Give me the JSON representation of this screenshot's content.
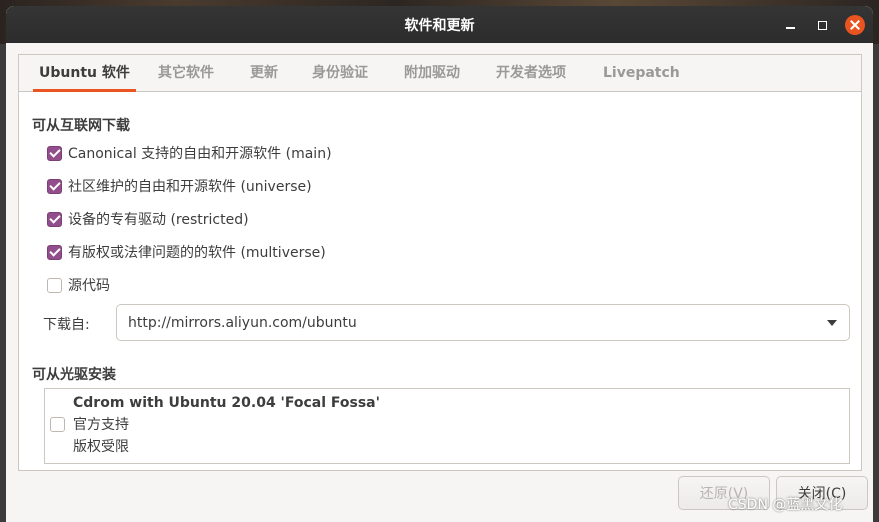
{
  "window": {
    "title": "软件和更新"
  },
  "tabs": [
    {
      "label": "Ubuntu 软件",
      "active": true
    },
    {
      "label": "其它软件",
      "active": false
    },
    {
      "label": "更新",
      "active": false
    },
    {
      "label": "身份验证",
      "active": false
    },
    {
      "label": "附加驱动",
      "active": false
    },
    {
      "label": "开发者选项",
      "active": false
    },
    {
      "label": "Livepatch",
      "active": false
    }
  ],
  "internet": {
    "heading": "可从互联网下载",
    "options": [
      {
        "label": "Canonical 支持的自由和开源软件 (main)",
        "checked": true
      },
      {
        "label": "社区维护的自由和开源软件 (universe)",
        "checked": true
      },
      {
        "label": "设备的专有驱动 (restricted)",
        "checked": true
      },
      {
        "label": "有版权或法律问题的的软件 (multiverse)",
        "checked": true
      },
      {
        "label": "源代码",
        "checked": false
      }
    ],
    "download_from_label": "下载自:",
    "mirror": "http://mirrors.aliyun.com/ubuntu"
  },
  "cdrom": {
    "heading": "可从光驱安装",
    "title": "Cdrom with Ubuntu 20.04 'Focal Fossa'",
    "line1": "官方支持",
    "line2": "版权受限",
    "checked": false
  },
  "buttons": {
    "revert": "还原(V)",
    "close": "关闭(C)"
  },
  "watermark": "CSDN @蓝黑文化",
  "colors": {
    "accent": "#e95420",
    "checkbox": "#924d8b",
    "titlebar": "#2c2c2c"
  },
  "icons": [
    "minimize-icon",
    "maximize-icon",
    "close-icon",
    "chevron-down-icon"
  ]
}
